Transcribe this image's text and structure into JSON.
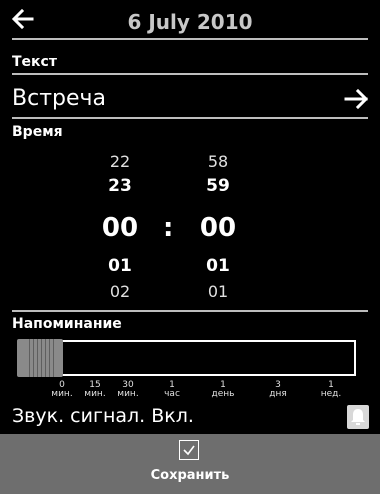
{
  "header": {
    "title": "6 July 2010",
    "back_icon": "back-arrow-icon"
  },
  "text_section": {
    "label": "Текст",
    "value": "Встреча",
    "arrow_icon": "arrow-right-icon"
  },
  "time_section": {
    "label": "Время",
    "hours": {
      "above2": "22",
      "above1": "23",
      "selected": "00",
      "below1": "01",
      "below2": "02"
    },
    "minutes": {
      "above2": "58",
      "above1": "59",
      "selected": "00",
      "below1": "01",
      "below2": "01"
    },
    "separator": ":"
  },
  "reminder_section": {
    "label": "Напоминание",
    "slider_position": 0,
    "ticks": [
      {
        "top": "0",
        "bottom": "мин."
      },
      {
        "top": "15",
        "bottom": "мин."
      },
      {
        "top": "30",
        "bottom": "мин."
      },
      {
        "top": "1",
        "bottom": "час"
      },
      {
        "top": "1",
        "bottom": "день"
      },
      {
        "top": "3",
        "bottom": "дня"
      },
      {
        "top": "1",
        "bottom": "нед."
      }
    ]
  },
  "sound": {
    "label": "Звук. сигнал. Вкл.",
    "icon": "bell-icon"
  },
  "footer": {
    "save_label": "Сохранить",
    "checkbox_checked": true
  },
  "colors": {
    "background": "#000000",
    "footer": "#6e6e6e",
    "accent": "#ffffff",
    "slider_thumb": "#8a8a8a"
  }
}
